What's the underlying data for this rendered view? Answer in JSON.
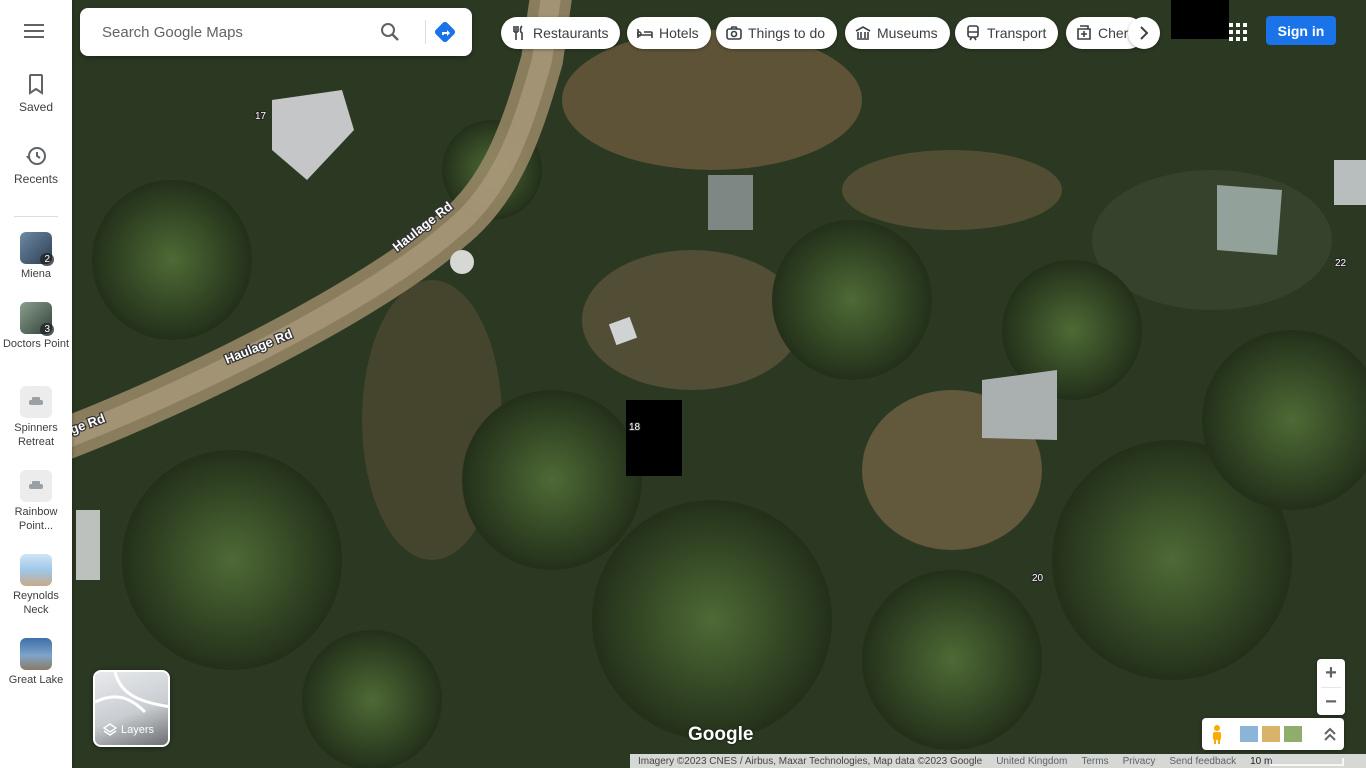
{
  "rail": {
    "saved_label": "Saved",
    "recents_label": "Recents",
    "recent_places": [
      {
        "label": "Miena",
        "badge": "2",
        "color": "#3d5a73"
      },
      {
        "label": "Doctors Point",
        "badge": "3",
        "color": "#556b5a"
      },
      {
        "label": "Spinners Retreat",
        "badge": "",
        "color": "#e8e8e8"
      },
      {
        "label": "Rainbow Point...",
        "badge": "",
        "color": "#e8e8e8"
      },
      {
        "label": "Reynolds Neck",
        "badge": "",
        "color": "#9ec7e6"
      },
      {
        "label": "Great Lake",
        "badge": "",
        "color": "#4b7fb0"
      }
    ]
  },
  "search": {
    "placeholder": "Search Google Maps"
  },
  "chips": [
    {
      "label": "Restaurants",
      "icon": "fork-knife-icon"
    },
    {
      "label": "Hotels",
      "icon": "bed-icon"
    },
    {
      "label": "Things to do",
      "icon": "camera-icon"
    },
    {
      "label": "Museums",
      "icon": "museum-icon"
    },
    {
      "label": "Transport",
      "icon": "train-icon"
    },
    {
      "label": "Chem",
      "icon": "pharmacy-icon"
    }
  ],
  "header": {
    "signin_label": "Sign in"
  },
  "layers": {
    "label": "Layers"
  },
  "map": {
    "roads": [
      {
        "label": "Haulage Rd"
      },
      {
        "label": "Haulage Rd"
      },
      {
        "label": "ge Rd"
      }
    ],
    "addresses": [
      "17",
      "18",
      "20",
      "22"
    ],
    "logo": "Google"
  },
  "footer": {
    "attribution": "Imagery ©2023 CNES / Airbus, Maxar Technologies, Map data ©2023 Google",
    "region": "United Kingdom",
    "terms": "Terms",
    "privacy": "Privacy",
    "feedback": "Send feedback",
    "scale": "10 m"
  },
  "colors": {
    "accent": "#1a73e8"
  }
}
